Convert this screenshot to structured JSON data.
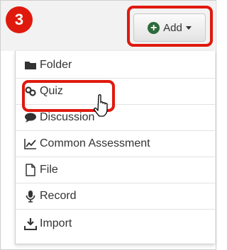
{
  "step": {
    "number": "3"
  },
  "add_button": {
    "label": "Add",
    "icon": "plus-circle-icon"
  },
  "menu": {
    "items": [
      {
        "label": "Folder",
        "icon": "folder-icon"
      },
      {
        "label": "Quiz",
        "icon": "quiz-icon"
      },
      {
        "label": "Discussion",
        "icon": "discussion-icon"
      },
      {
        "label": "Common Assessment",
        "icon": "line-chart-icon"
      },
      {
        "label": "File",
        "icon": "file-icon"
      },
      {
        "label": "Record",
        "icon": "microphone-icon"
      },
      {
        "label": "Import",
        "icon": "download-icon"
      }
    ]
  },
  "colors": {
    "highlight": "#e0190e",
    "add_icon": "#2e6b3a",
    "text": "#333333"
  }
}
